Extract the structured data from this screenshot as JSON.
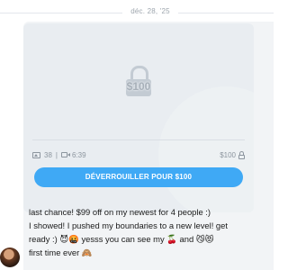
{
  "date_separator": "déc. 28, '25",
  "post": {
    "locked_price": "$100",
    "stats": {
      "photos": "38",
      "video_duration": "6:39"
    },
    "price_label": "$100",
    "unlock_button": "DÉVERROUILLER POUR $100",
    "text_lines": [
      "last chance! $99 off on my newest for 4 people :)",
      "I showed! I pushed my boundaries to a new level! get",
      "ready :) 😈🤬 yesss you can see my 🍒 and 😼😻",
      "first time ever 🙈"
    ]
  },
  "colors": {
    "accent": "#3fa9f5",
    "bubble": "#f2f4f6",
    "card": "#e9edf1"
  },
  "icons": [
    "lock-icon",
    "image-icon",
    "video-icon",
    "avatar"
  ]
}
